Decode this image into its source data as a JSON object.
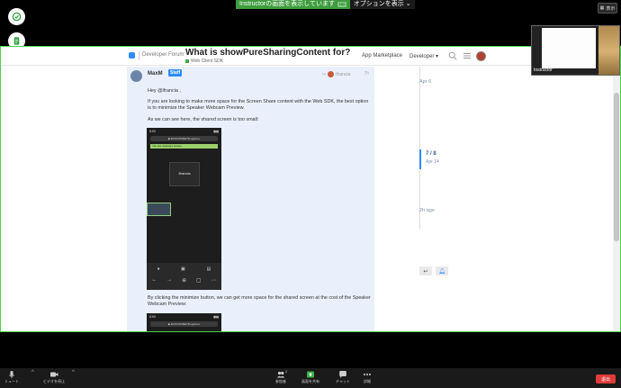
{
  "banner": {
    "sharing_text": "Instructorの画面を表示しています",
    "sharing_badge": "HD",
    "options_label": "オプションを表示"
  },
  "display_button": {
    "label": "表示"
  },
  "forum": {
    "brand": "Developer Forum",
    "topic_title": "What is showPureSharingContent for?",
    "category": "Web Client SDK",
    "nav_marketplace": "App Marketplace",
    "nav_developer": "Developer"
  },
  "post": {
    "username": "MaxM",
    "staff_label": "Staff",
    "reply_to": "ifrancia",
    "date": "7h",
    "greeting": "Hey @ifrancia ,",
    "para1": "If you are looking to make more space for the Screen Share content with the Web SDK, the best option is to minimize the Speaker Webcam Preview.",
    "para2": "As we can see here, the shared screen is too small:",
    "para3": "By clicking the minimize button, we can get more space for the shared screen at the cost of the Speaker Webcam Preview:",
    "phone_time": "8:59",
    "phone_url": "■ 3047237fd6d78.ngrok.io",
    "phone_sharing": "You are viewing's screen",
    "phone_tile_label": "Ifrancia"
  },
  "timeline": {
    "top_date": "Apr 6",
    "position": "7 / 8",
    "position_date": "Apr 14",
    "bottom_date": "2h ago"
  },
  "video": {
    "label": "Instructor"
  },
  "toolbar": {
    "mute": "ミュート",
    "video": "ビデオを停止",
    "participants": "参加者",
    "participants_count": "2",
    "share": "画面を共有",
    "chat": "チャット",
    "more": "詳細",
    "leave": "退出"
  }
}
